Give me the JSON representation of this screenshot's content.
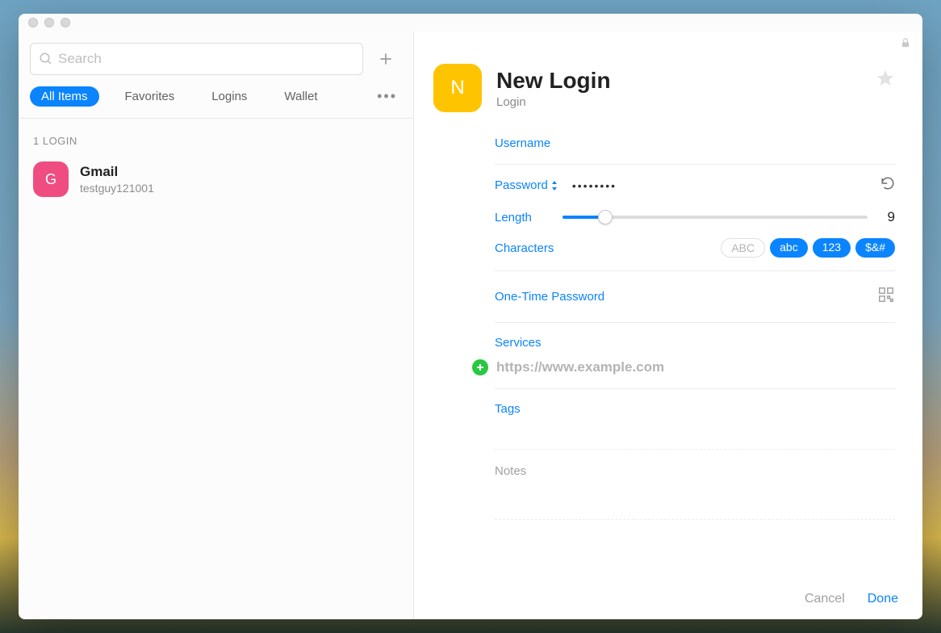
{
  "search": {
    "placeholder": "Search"
  },
  "categories": {
    "items": [
      {
        "label": "All Items",
        "active": true
      },
      {
        "label": "Favorites",
        "active": false
      },
      {
        "label": "Logins",
        "active": false
      },
      {
        "label": "Wallet",
        "active": false
      }
    ]
  },
  "sidebar": {
    "section_label": "1 LOGIN",
    "items": [
      {
        "initial": "G",
        "title": "Gmail",
        "subtitle": "testguy121001",
        "color": "#ef4d82"
      }
    ]
  },
  "detail": {
    "initial": "N",
    "title": "New Login",
    "subtitle": "Login",
    "username_label": "Username",
    "password_label": "Password",
    "password_value": "••••••••",
    "length_label": "Length",
    "length_value": "9",
    "length_percent": 14,
    "characters_label": "Characters",
    "char_options": [
      {
        "label": "ABC",
        "active": false
      },
      {
        "label": "abc",
        "active": true
      },
      {
        "label": "123",
        "active": true
      },
      {
        "label": "$&#",
        "active": true
      }
    ],
    "otp_label": "One-Time Password",
    "services_label": "Services",
    "services_placeholder": "https://www.example.com",
    "tags_label": "Tags",
    "notes_label": "Notes"
  },
  "footer": {
    "cancel": "Cancel",
    "done": "Done"
  }
}
